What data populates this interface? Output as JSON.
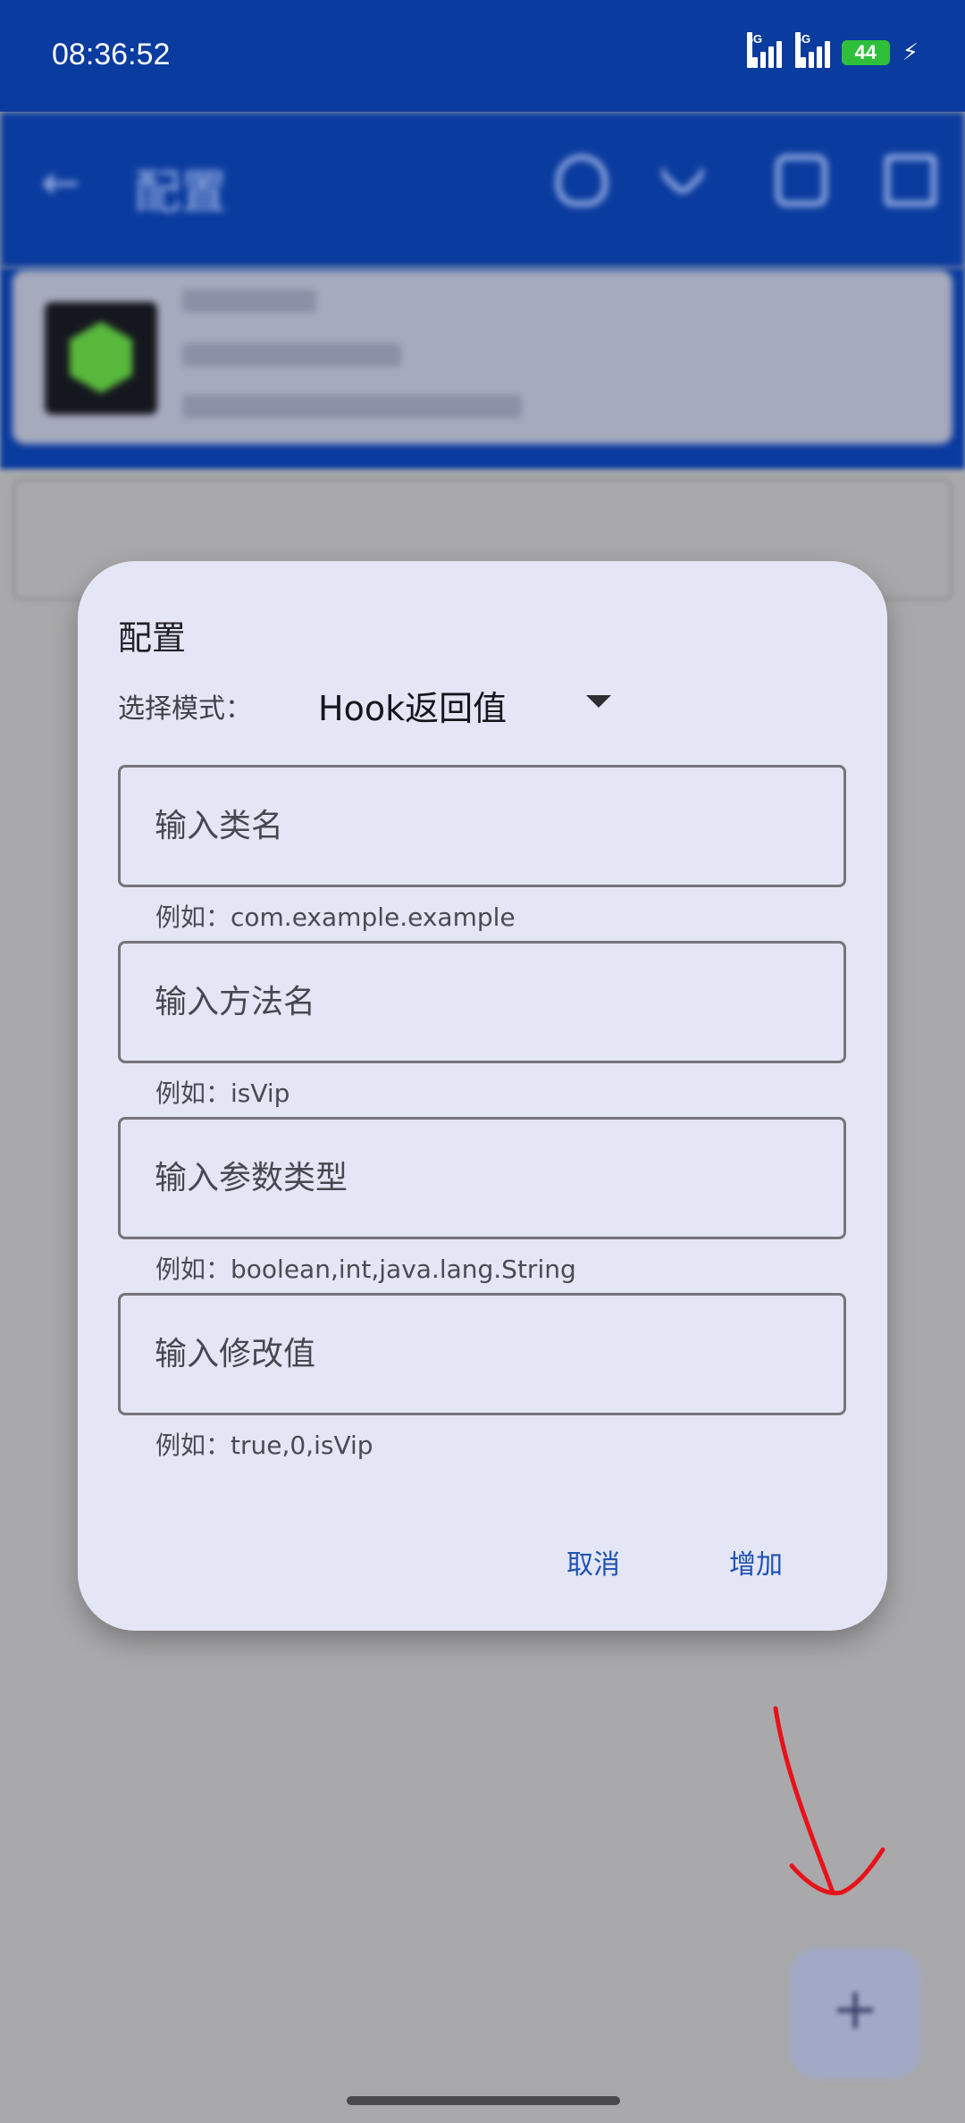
{
  "status_bar": {
    "time": "08:36:52",
    "signal_1": "5G",
    "signal_2": "5G",
    "battery": "44"
  },
  "app_bar": {
    "back_icon": "arrow-left-icon",
    "title": "配置",
    "icons": [
      "heart-icon",
      "tool-icon",
      "clipboard-icon",
      "save-icon"
    ]
  },
  "dialog": {
    "title": "配置",
    "mode_label": "选择模式：",
    "mode_value": "Hook返回值",
    "fields": [
      {
        "placeholder": "输入类名",
        "hint": "例如：com.example.example"
      },
      {
        "placeholder": "输入方法名",
        "hint": "例如：isVip"
      },
      {
        "placeholder": "输入参数类型",
        "hint": "例如：boolean,int,java.lang.String"
      },
      {
        "placeholder": "输入修改值",
        "hint": "例如：true,0,isVip"
      }
    ],
    "cancel_label": "取消",
    "add_label": "增加"
  },
  "colors": {
    "primary": "#0a3b9e",
    "dialog_bg": "#e4e6f5",
    "accent_text": "#1f52b4",
    "battery": "#2fbf3b",
    "annotation": "#e8121b"
  }
}
